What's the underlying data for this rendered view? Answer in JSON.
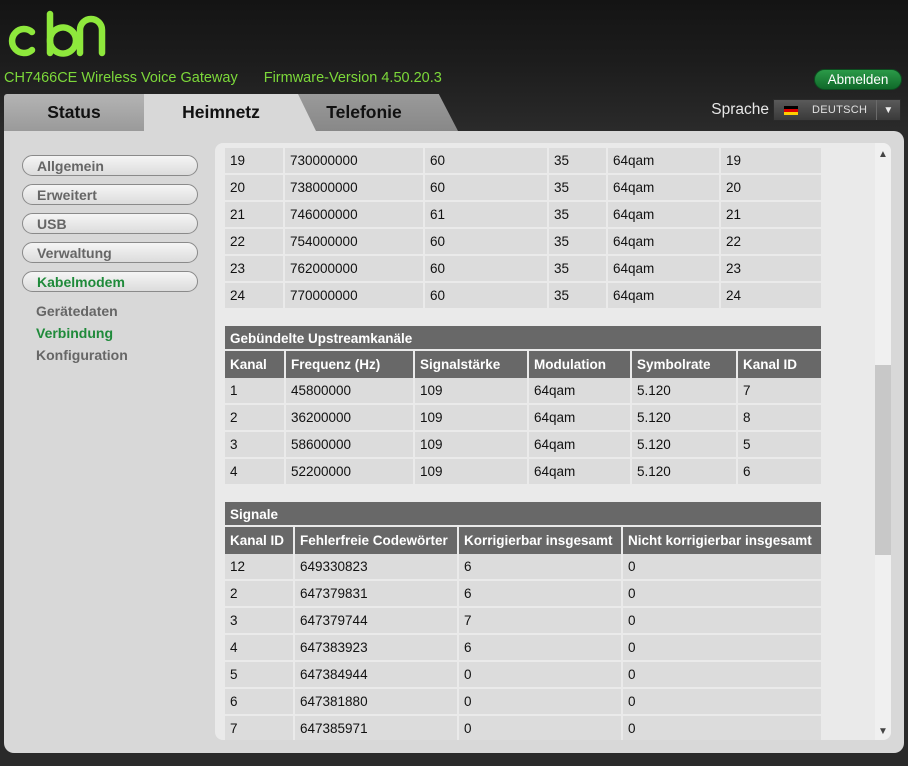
{
  "header": {
    "logo_text": "cbn",
    "device": "CH7466CE  Wireless Voice Gateway",
    "firmware": "Firmware-Version  4.50.20.3",
    "logout_label": "Abmelden"
  },
  "tabs": [
    {
      "label": "Status"
    },
    {
      "label": "Heimnetz"
    },
    {
      "label": "Telefonie"
    }
  ],
  "language": {
    "label": "Sprache",
    "selected": "DEUTSCH"
  },
  "sidebar": {
    "items": [
      {
        "label": "Allgemein"
      },
      {
        "label": "Erweitert"
      },
      {
        "label": "USB"
      },
      {
        "label": "Verwaltung"
      },
      {
        "label": "Kabelmodem"
      }
    ],
    "subitems": [
      {
        "label": "Gerätedaten"
      },
      {
        "label": "Verbindung"
      },
      {
        "label": "Konfiguration"
      }
    ]
  },
  "downstream": {
    "rows": [
      [
        "19",
        "730000000",
        "60",
        "35",
        "64qam",
        "19"
      ],
      [
        "20",
        "738000000",
        "60",
        "35",
        "64qam",
        "20"
      ],
      [
        "21",
        "746000000",
        "61",
        "35",
        "64qam",
        "21"
      ],
      [
        "22",
        "754000000",
        "60",
        "35",
        "64qam",
        "22"
      ],
      [
        "23",
        "762000000",
        "60",
        "35",
        "64qam",
        "23"
      ],
      [
        "24",
        "770000000",
        "60",
        "35",
        "64qam",
        "24"
      ]
    ]
  },
  "upstream": {
    "title": "Gebündelte Upstreamkanäle",
    "headers": [
      "Kanal",
      "Frequenz (Hz)",
      "Signalstärke",
      "Modulation",
      "Symbolrate",
      "Kanal ID"
    ],
    "rows": [
      [
        "1",
        "45800000",
        "109",
        "64qam",
        "5.120",
        "7"
      ],
      [
        "2",
        "36200000",
        "109",
        "64qam",
        "5.120",
        "8"
      ],
      [
        "3",
        "58600000",
        "109",
        "64qam",
        "5.120",
        "5"
      ],
      [
        "4",
        "52200000",
        "109",
        "64qam",
        "5.120",
        "6"
      ]
    ]
  },
  "signals": {
    "title": "Signale",
    "headers": [
      "Kanal ID",
      "Fehlerfreie Codewörter",
      "Korrigierbar insgesamt",
      "Nicht korrigierbar insgesamt"
    ],
    "rows": [
      [
        "12",
        "649330823",
        "6",
        "0"
      ],
      [
        "2",
        "647379831",
        "6",
        "0"
      ],
      [
        "3",
        "647379744",
        "7",
        "0"
      ],
      [
        "4",
        "647383923",
        "6",
        "0"
      ],
      [
        "5",
        "647384944",
        "0",
        "0"
      ],
      [
        "6",
        "647381880",
        "0",
        "0"
      ],
      [
        "7",
        "647385971",
        "0",
        "0"
      ]
    ]
  },
  "colors": {
    "accent_green": "#7cd83a",
    "active_nav": "#1f8a3a",
    "header_gray": "#686868"
  }
}
